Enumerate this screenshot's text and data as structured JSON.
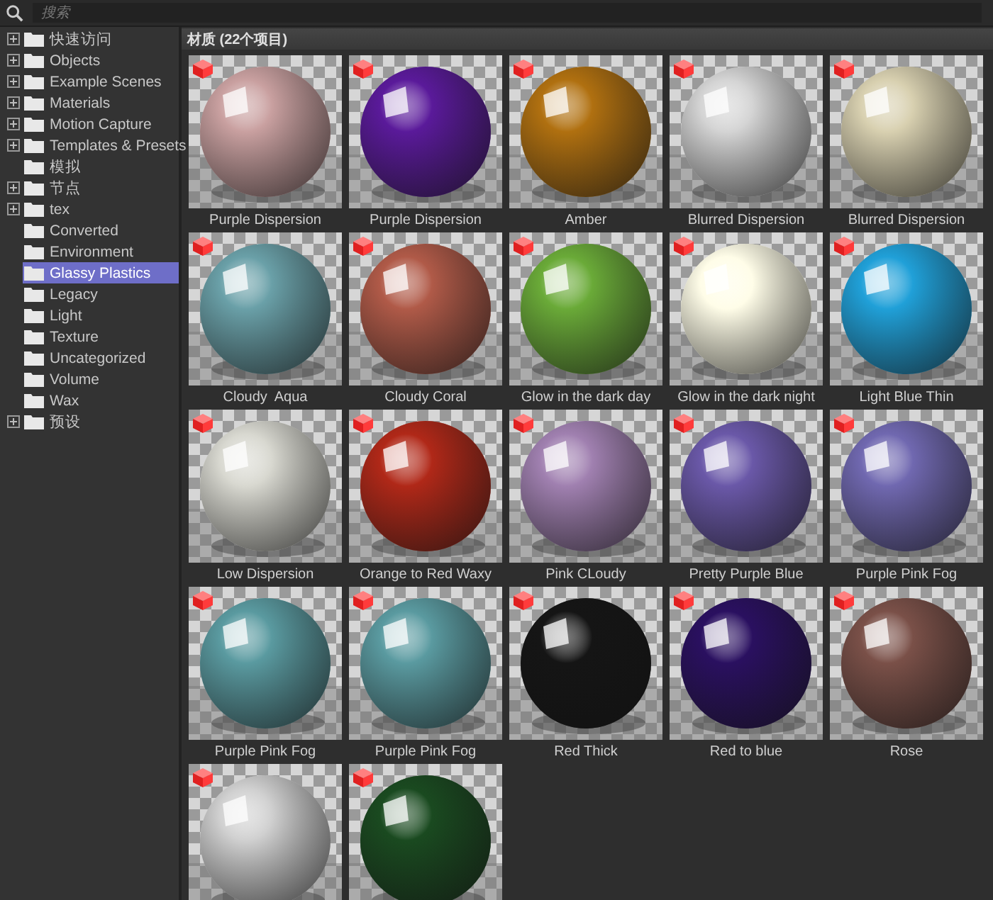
{
  "search": {
    "placeholder": "搜索"
  },
  "tree": [
    {
      "label": "快速访问",
      "collapsed": true,
      "selected": false
    },
    {
      "label": "Objects",
      "collapsed": true,
      "selected": false
    },
    {
      "label": "Example Scenes",
      "collapsed": true,
      "selected": false
    },
    {
      "label": "Materials",
      "collapsed": true,
      "selected": false
    },
    {
      "label": "Motion Capture",
      "collapsed": true,
      "selected": false
    },
    {
      "label": "Templates & Presets",
      "collapsed": true,
      "selected": false
    },
    {
      "label": "模拟",
      "collapsed": false,
      "selected": false
    },
    {
      "label": "节点",
      "collapsed": true,
      "selected": false
    },
    {
      "label": "tex",
      "collapsed": true,
      "selected": false
    },
    {
      "label": "Converted",
      "collapsed": false,
      "selected": false
    },
    {
      "label": "Environment",
      "collapsed": false,
      "selected": false
    },
    {
      "label": "Glassy Plastics",
      "collapsed": false,
      "selected": true
    },
    {
      "label": "Legacy",
      "collapsed": false,
      "selected": false
    },
    {
      "label": "Light",
      "collapsed": false,
      "selected": false
    },
    {
      "label": "Texture",
      "collapsed": false,
      "selected": false
    },
    {
      "label": "Uncategorized",
      "collapsed": false,
      "selected": false
    },
    {
      "label": "Volume",
      "collapsed": false,
      "selected": false
    },
    {
      "label": "Wax",
      "collapsed": false,
      "selected": false
    },
    {
      "label": "预设",
      "collapsed": true,
      "selected": false
    }
  ],
  "panel": {
    "title": "材质 (22个项目)"
  },
  "materials": [
    {
      "name": "Purple Dispersion",
      "kind": "picture"
    },
    {
      "name": "Purple Dispersion",
      "kind": "picture"
    },
    {
      "name": "Amber",
      "kind": "picture"
    },
    {
      "name": "Blurred Dispersion",
      "kind": "picture"
    },
    {
      "name": "Blurred Dispersion",
      "kind": "picture"
    },
    {
      "name": "Cloudy  Aqua",
      "kind": "picture"
    },
    {
      "name": "Cloudy Coral",
      "kind": "picture"
    },
    {
      "name": "Glow in the dark day",
      "kind": "picture"
    },
    {
      "name": "Glow in the dark night",
      "kind": "picture"
    },
    {
      "name": "Light Blue Thin",
      "kind": "picture"
    },
    {
      "name": "Low Dispersion",
      "kind": "picture"
    },
    {
      "name": "Orange to Red Waxy",
      "kind": "picture"
    },
    {
      "name": "Pink CLoudy",
      "kind": "picture"
    },
    {
      "name": "Pretty Purple Blue",
      "kind": "picture"
    },
    {
      "name": "Purple Pink Fog",
      "kind": "picture"
    },
    {
      "name": "Purple Pink Fog",
      "kind": "picture"
    },
    {
      "name": "Purple Pink Fog",
      "kind": "picture"
    },
    {
      "name": "Red Thick",
      "kind": "picture"
    },
    {
      "name": "Red to blue",
      "kind": "picture"
    },
    {
      "name": "Rose",
      "kind": "picture"
    },
    {
      "kind": "picture"
    },
    {
      "kind": "picture"
    }
  ]
}
